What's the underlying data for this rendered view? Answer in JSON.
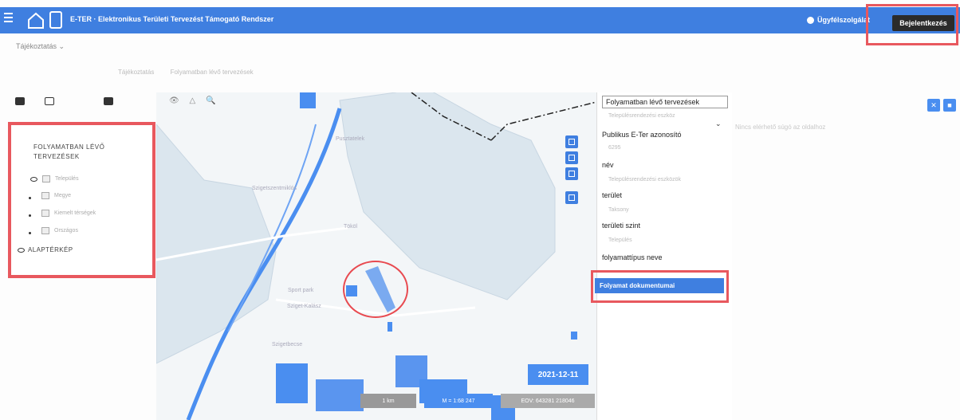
{
  "header": {
    "title": "E-TER · Elektronikus Területi Tervezést Támogató Rendszer",
    "help_label": "Ügyfélszolgálat",
    "login_label": "Bejelentkezés"
  },
  "info_menu": {
    "label": "Tájékoztatás"
  },
  "subtabs": [
    "Tájékoztatás",
    "Folyamatban lévő tervezések"
  ],
  "layers": {
    "title_line1": "FOLYAMATBAN LÉVŐ",
    "title_line2": "TERVEZÉSEK",
    "items": [
      "Település",
      "Megye",
      "Kiemelt térségek",
      "Országos"
    ],
    "base_map": "ALAPTÉRKÉP"
  },
  "map": {
    "labels": [
      "Pusztatelek",
      "Szigetszentmiklós",
      "Tököl",
      "Sport park",
      "Sziget-Kalász",
      "Szigetbecse"
    ],
    "date": "2021-12-11",
    "scale_left": "1 km",
    "scale_mid": "M = 1:68 247",
    "coords": "EOV: 643281 218046"
  },
  "detail": {
    "header": "Folyamatban lévő tervezések",
    "dropdown_value": "Településrendezési eszköz",
    "fields": [
      {
        "label": "Publikus E-Ter azonosító",
        "value": "6295"
      },
      {
        "label": "név",
        "value": "Településrendezési eszközök"
      },
      {
        "label": "terület",
        "value": "Taksony"
      },
      {
        "label": "területi szint",
        "value": "Település"
      },
      {
        "label": "folyamattípus neve",
        "value": ""
      }
    ],
    "documents_button": "Folyamat dokumentumai"
  },
  "help_panel": {
    "text": "Nincs elérhető súgó az oldalhoz"
  },
  "colors": {
    "header": "#3f7fe0",
    "highlight": "#e8585e",
    "map_water": "#4a8ef0",
    "map_area": "#dbe6ee"
  }
}
